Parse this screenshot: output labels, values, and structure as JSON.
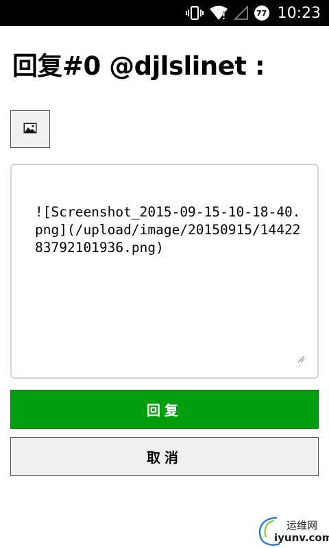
{
  "status_bar": {
    "time": "10:23",
    "battery_level": "77",
    "icons": [
      "vibrate-icon",
      "wifi-icon",
      "signal-icon",
      "battery-icon"
    ]
  },
  "page": {
    "title": "回复#0 @djlslinet :"
  },
  "toolbar": {
    "image_button_icon": "image-icon"
  },
  "editor": {
    "value": "![Screenshot_2015-09-15-10-18-40.png](/upload/image/20150915/1442283792101936.png)"
  },
  "actions": {
    "submit_label": "回复",
    "cancel_label": "取消"
  },
  "watermark": {
    "cn": "运维网",
    "en": "iyunv.com"
  },
  "colors": {
    "submit_bg": "#009e0f",
    "cancel_bg": "#efefef",
    "status_bar_bg": "#000000"
  }
}
